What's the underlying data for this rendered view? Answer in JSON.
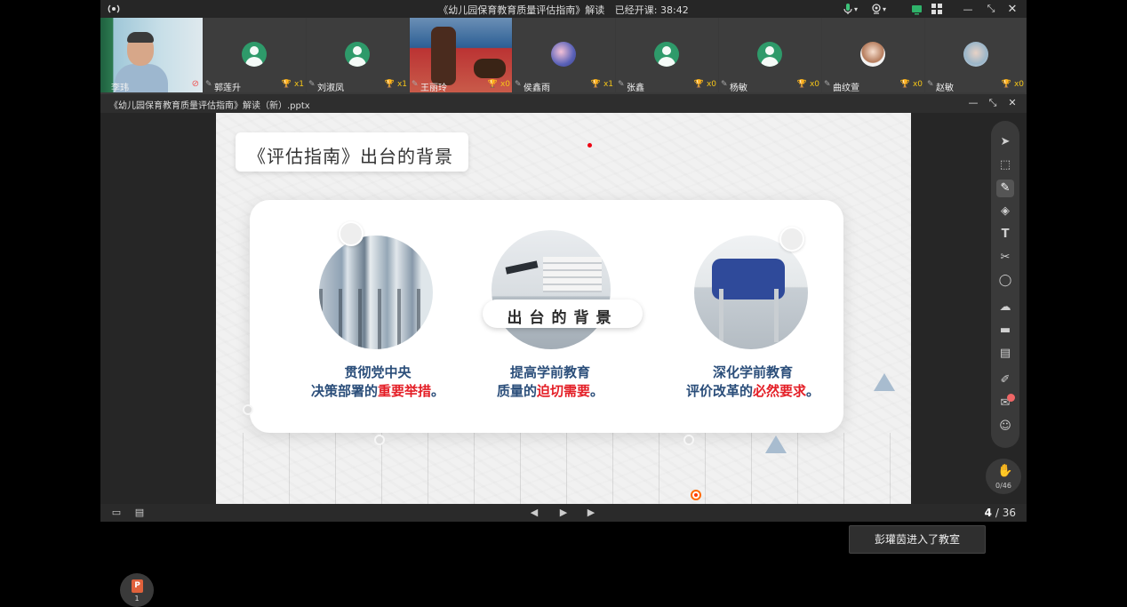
{
  "window": {
    "title": "《幼儿园保育教育质量评估指南》解读",
    "elapsed_label": "已经开课:",
    "elapsed_time": "38:42"
  },
  "participants": [
    {
      "name": "李玮",
      "type": "camera"
    },
    {
      "name": "郭莲升",
      "count": "x1",
      "type": "avatar"
    },
    {
      "name": "刘淑凤",
      "count": "x1",
      "type": "avatar"
    },
    {
      "name": "王丽玲",
      "count": "x0",
      "type": "camera"
    },
    {
      "name": "侯鑫雨",
      "count": "x1",
      "type": "photo"
    },
    {
      "name": "张鑫",
      "count": "x0",
      "type": "avatar"
    },
    {
      "name": "杨敏",
      "count": "x0",
      "type": "avatar"
    },
    {
      "name": "曲纹萱",
      "count": "x0",
      "type": "photo"
    },
    {
      "name": "赵敏",
      "count": "x0",
      "type": "photo"
    }
  ],
  "document": {
    "filename": "《幼儿园保育教育质量评估指南》解读（新）.pptx"
  },
  "slide": {
    "title": "《评估指南》出台的背景",
    "center_label": "出台的背景",
    "items": [
      {
        "line1": "贯彻党中央",
        "line2_prefix": "决策部署的",
        "highlight": "重要举措",
        "suffix": "。"
      },
      {
        "line1": "提高学前教育",
        "line2_prefix": "质量的",
        "highlight": "迫切需要",
        "suffix": "。"
      },
      {
        "line1": "深化学前教育",
        "line2_prefix": "评价改革的",
        "highlight": "必然要求",
        "suffix": "。"
      }
    ]
  },
  "notification": "彭瓘茵进入了教室",
  "ppt_badge": {
    "letter": "P",
    "count": "1"
  },
  "hand_raise": {
    "count": "0/46"
  },
  "pager": {
    "current": "4",
    "separator": "/",
    "total": "36"
  },
  "colors": {
    "accent_text": "#2b4e7a",
    "highlight": "#e41e26",
    "avatar_green": "#2e9a6a",
    "trophy": "#f5c518"
  }
}
